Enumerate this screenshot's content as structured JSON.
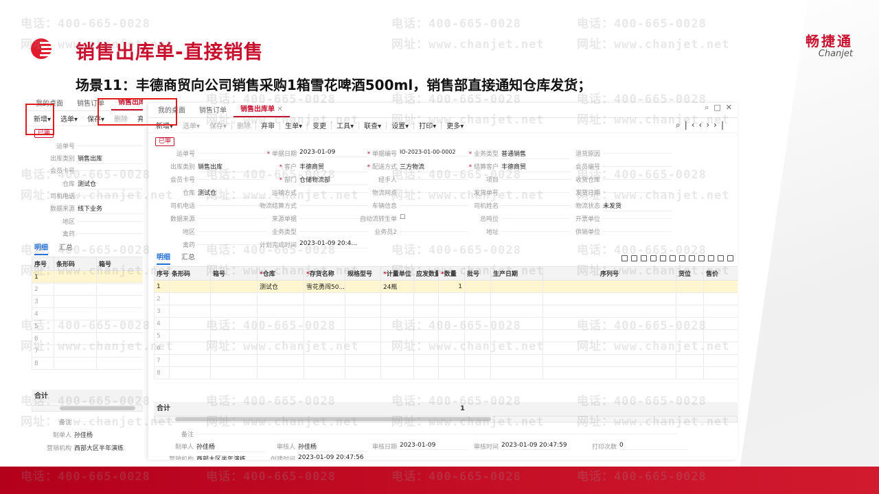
{
  "slide": {
    "title": "销售出库单-直接销售",
    "subtitle": "场景11：丰德商贸向公司销售采购1箱雪花啤酒500ml，销售部直接通知仓库发货；",
    "brand_cn": "畅捷通",
    "brand_en": "Chanjet"
  },
  "watermark": {
    "phone": "电话：400-665-0028",
    "site": "网址：www.chanjet.net"
  },
  "bg_shot": {
    "tabs": [
      "我的桌面",
      "销售订单",
      "销售出库单"
    ],
    "toolbar": [
      "新增▾",
      "选单▾",
      "保存▾",
      "删除",
      "弃"
    ],
    "stamp": "已审",
    "fields": [
      {
        "label": "运单号",
        "value": ""
      },
      {
        "label": "出库类别",
        "value": "销售出库"
      },
      {
        "label": "会员卡号",
        "value": ""
      },
      {
        "label": "仓库",
        "value": "测试仓"
      },
      {
        "label": "司机电话",
        "value": ""
      },
      {
        "label": "数据来源",
        "value": "线下业务"
      },
      {
        "label": "地区",
        "value": ""
      },
      {
        "label": "禽药",
        "value": ""
      }
    ],
    "sec_tabs": [
      "明细",
      "汇总"
    ],
    "headers": [
      "序号",
      "条形码",
      "箱号"
    ],
    "rows": [
      "1",
      "2",
      "3",
      "4",
      "5",
      "6",
      "7",
      "8"
    ],
    "total_label": "合计",
    "footer": [
      {
        "label": "备注",
        "value": ""
      },
      {
        "label": "制单人",
        "value": "孙佳杨"
      },
      {
        "label": "营销机构",
        "value": "西部大区半年演练"
      }
    ]
  },
  "main_shot": {
    "tabs": [
      "我的桌面",
      "销售订单",
      "销售出库单"
    ],
    "toolbar": [
      "新增▾",
      "选单▾",
      "保存▾",
      "删除",
      "弃审",
      "生单▾",
      "变更",
      "工具▾",
      "联查▾",
      "设置▾",
      "打印▾",
      "更多▾"
    ],
    "stamp": "已审",
    "fields": [
      {
        "label": "运单号",
        "value": "",
        "req": false
      },
      {
        "label": "单据日期",
        "value": "2023-01-09",
        "req": true
      },
      {
        "label": "单据编号",
        "value": "IO-2023-01-00-0002",
        "req": true
      },
      {
        "label": "业务类型",
        "value": "普通销售",
        "req": true
      },
      {
        "label": "退货原因",
        "value": "",
        "req": false
      },
      {
        "label": "出库类别",
        "value": "销售出库",
        "req": false
      },
      {
        "label": "客户",
        "value": "丰德商贸",
        "req": true
      },
      {
        "label": "配送方式",
        "value": "三方物流",
        "req": true
      },
      {
        "label": "结算客户",
        "value": "丰德商贸",
        "req": true
      },
      {
        "label": "会员编号",
        "value": "",
        "req": false
      },
      {
        "label": "会员卡号",
        "value": "",
        "req": false
      },
      {
        "label": "部门",
        "value": "仓储物流部",
        "req": true
      },
      {
        "label": "经手人",
        "value": "",
        "req": false
      },
      {
        "label": "项目",
        "value": "",
        "req": false
      },
      {
        "label": "收货仓库",
        "value": "",
        "req": false
      },
      {
        "label": "仓库",
        "value": "测试仓",
        "req": false
      },
      {
        "label": "运输方式",
        "value": "",
        "req": false
      },
      {
        "label": "物流网点",
        "value": "",
        "req": false
      },
      {
        "label": "发货单号",
        "value": "",
        "req": false
      },
      {
        "label": "发货日期",
        "value": "",
        "req": false
      },
      {
        "label": "司机电话",
        "value": "",
        "req": false
      },
      {
        "label": "物流结算方式",
        "value": "",
        "req": false
      },
      {
        "label": "车辆信息",
        "value": "",
        "req": false
      },
      {
        "label": "司机姓名",
        "value": "",
        "req": false
      },
      {
        "label": "物流状态",
        "value": "未发货",
        "req": false
      },
      {
        "label": "数据来源",
        "value": "",
        "req": false
      },
      {
        "label": "来源单据",
        "value": "",
        "req": false
      },
      {
        "label": "自动流转生单",
        "value": "☐",
        "req": false
      },
      {
        "label": "总吨位",
        "value": "",
        "req": false
      },
      {
        "label": "开票单位",
        "value": "",
        "req": false
      },
      {
        "label": "地区",
        "value": "",
        "req": false
      },
      {
        "label": "业务类型",
        "value": "",
        "req": false
      },
      {
        "label": "业务员2",
        "value": "",
        "req": false
      },
      {
        "label": "地址",
        "value": "",
        "req": false
      },
      {
        "label": "供销单位",
        "value": "",
        "req": false
      },
      {
        "label": "禽药",
        "value": "",
        "req": false
      },
      {
        "label": "计划完成时间",
        "value": "2023-01-09 20:4...",
        "req": false
      }
    ],
    "sec_tabs": [
      "明细",
      "汇总"
    ],
    "headers": [
      {
        "t": "序号",
        "req": false
      },
      {
        "t": "条形码",
        "req": false
      },
      {
        "t": "箱号",
        "req": false
      },
      {
        "t": "仓库",
        "req": true
      },
      {
        "t": "存货名称",
        "req": true
      },
      {
        "t": "规格型号",
        "req": false
      },
      {
        "t": "计量单位",
        "req": true
      },
      {
        "t": "应发数量",
        "req": false
      },
      {
        "t": "数量",
        "req": true
      },
      {
        "t": "批号",
        "req": false
      },
      {
        "t": "生产日期",
        "req": false
      },
      {
        "t": "序列号",
        "req": false
      },
      {
        "t": "货位",
        "req": false
      },
      {
        "t": "售价",
        "req": false
      }
    ],
    "row1": [
      "1",
      "",
      "",
      "测试仓",
      "雪花勇闯50...",
      "",
      "24瓶",
      "",
      "1",
      "",
      "",
      "",
      "",
      ""
    ],
    "rows": [
      "2",
      "3",
      "4",
      "5",
      "6",
      "7",
      "8"
    ],
    "total_label": "合计",
    "total_qty": "1",
    "footer": [
      {
        "label": "备注",
        "value": ""
      },
      {
        "label": "制单人",
        "value": "孙佳杨"
      },
      {
        "label": "审核人",
        "value": "孙佳杨"
      },
      {
        "label": "审核日期",
        "value": "2023-01-09"
      },
      {
        "label": "审核时间",
        "value": "2023-01-09 20:47:59"
      },
      {
        "label": "打印次数",
        "value": "0"
      },
      {
        "label": "营销机构",
        "value": "西部大区半年演练"
      },
      {
        "label": "创建时间",
        "value": "2023-01-09 20:47:56"
      }
    ]
  }
}
